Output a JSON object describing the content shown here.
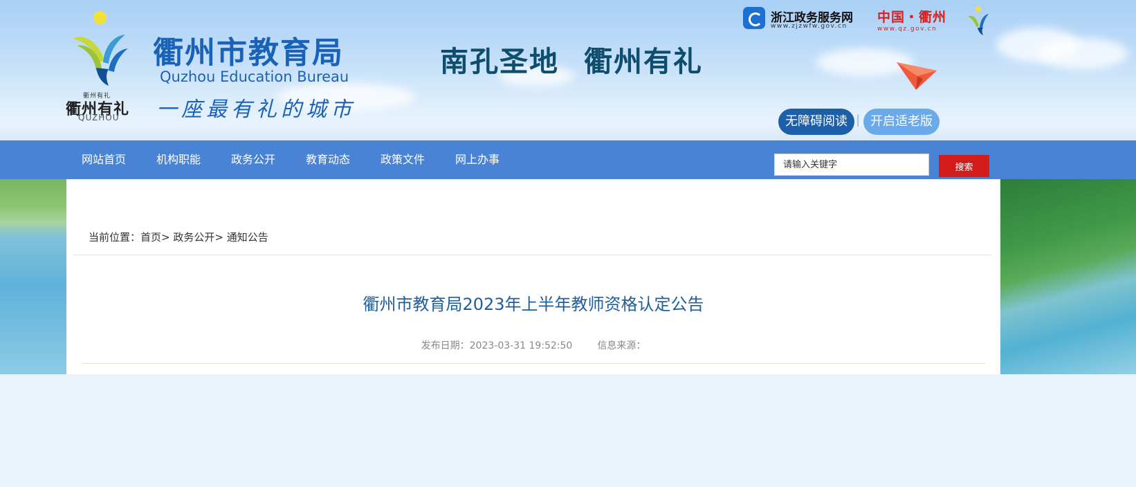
{
  "header": {
    "logo_small_cn": "衢州有礼",
    "logo_cn": "衢州有礼",
    "logo_en": "QUZHOU",
    "site_title": "衢州市教育局",
    "site_subtitle": "Quzhou Education Bureau",
    "slogan_handwritten": "一座最有礼的城市",
    "motto_part1": "南孔圣地",
    "motto_part2": "衢州有礼",
    "zjzw_name": "浙江政务服务网",
    "zjzw_url": "www.zjzwfw.gov.cn",
    "qz_name": "中国・衢州",
    "qz_url": "www.qz.gov.cn",
    "accessibility_button": "无障碍阅读",
    "elderly_mode_button": "开启适老版",
    "separator": "|"
  },
  "nav": {
    "items": [
      "网站首页",
      "机构职能",
      "政务公开",
      "教育动态",
      "政策文件",
      "网上办事"
    ],
    "search_placeholder": "请输入关键字",
    "search_button": "搜索"
  },
  "breadcrumb": {
    "prefix": "当前位置：",
    "items": [
      "首页",
      "政务公开",
      "通知公告"
    ]
  },
  "article": {
    "title": "衢州市教育局2023年上半年教师资格认定公告",
    "publish_label": "发布日期：",
    "publish_date": "2023-03-31 19:52:50",
    "source_label": "信息来源："
  },
  "colors": {
    "nav_bg": "#4a83d4",
    "search_button": "#d21c1c",
    "title_blue": "#1f5e9b",
    "brand_blue": "#1a62b8"
  }
}
